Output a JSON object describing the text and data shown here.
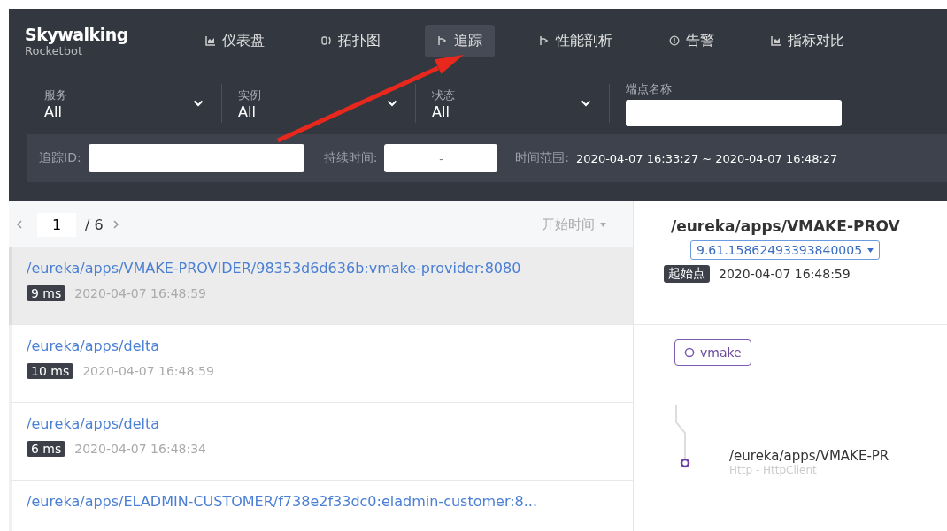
{
  "brand": {
    "name": "Skywalking",
    "subtitle": "Rocketbot"
  },
  "nav": [
    {
      "label": "仪表盘",
      "kind": "chart",
      "selected": false
    },
    {
      "label": "拓扑图",
      "kind": "topology",
      "selected": false
    },
    {
      "label": "追踪",
      "kind": "trace",
      "selected": true
    },
    {
      "label": "性能剖析",
      "kind": "trace",
      "selected": false
    },
    {
      "label": "告警",
      "kind": "alert",
      "selected": false
    },
    {
      "label": "指标对比",
      "kind": "chart",
      "selected": false
    }
  ],
  "filters": [
    {
      "label": "服务",
      "value": "All"
    },
    {
      "label": "实例",
      "value": "All"
    },
    {
      "label": "状态",
      "value": "All"
    }
  ],
  "endpoint_label": "端点名称",
  "trace_id_label": "追踪ID:",
  "duration_label": "持续时间:",
  "duration_placeholder": "-",
  "time_range_label": "时间范围:",
  "time_range": "2020-04-07 16:33:27 ~ 2020-04-07 16:48:27",
  "pagination": {
    "page": "1",
    "total": "/ 6",
    "sort": "开始时间"
  },
  "traces": [
    {
      "endpoint": "/eureka/apps/VMAKE-PROVIDER/98353d6d636b:vmake-provider:8080",
      "duration": "9 ms",
      "time": "2020-04-07 16:48:59",
      "selected": true
    },
    {
      "endpoint": "/eureka/apps/delta",
      "duration": "10 ms",
      "time": "2020-04-07 16:48:59",
      "selected": false
    },
    {
      "endpoint": "/eureka/apps/delta",
      "duration": "6 ms",
      "time": "2020-04-07 16:48:34",
      "selected": false
    },
    {
      "endpoint": "/eureka/apps/ELADMIN-CUSTOMER/f738e2f33dc0:eladmin-customer:8...",
      "selected": false
    }
  ],
  "detail": {
    "title": "/eureka/apps/VMAKE-PROV",
    "trace_id": "9.61.15862493393840005",
    "start_label": "起始点",
    "start_time": "2020-04-07 16:48:59",
    "service": "vmake",
    "span": {
      "name": "/eureka/apps/VMAKE-PR",
      "component": "Http - HttpClient"
    }
  }
}
